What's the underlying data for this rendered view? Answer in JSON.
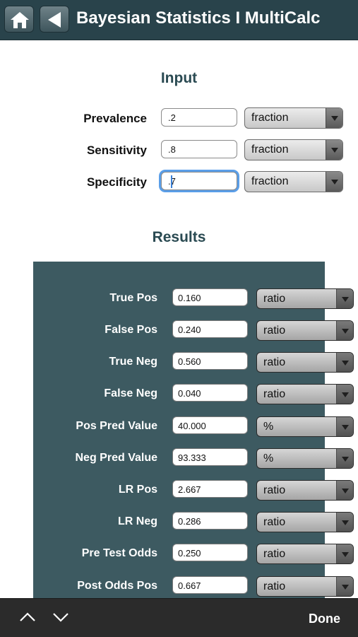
{
  "header": {
    "title": "Bayesian Statistics I MultiCalc",
    "home_icon": "home-icon",
    "back_icon": "back-arrow-icon"
  },
  "input": {
    "title": "Input",
    "rows": [
      {
        "label": "Prevalence",
        "value": ".2",
        "unit": "fraction"
      },
      {
        "label": "Sensitivity",
        "value": ".8",
        "unit": "fraction"
      },
      {
        "label": "Specificity",
        "value": ".7",
        "unit": "fraction"
      }
    ]
  },
  "results": {
    "title": "Results",
    "rows": [
      {
        "label": "True Pos",
        "value": "0.160",
        "unit": "ratio"
      },
      {
        "label": "False Pos",
        "value": "0.240",
        "unit": "ratio"
      },
      {
        "label": "True Neg",
        "value": "0.560",
        "unit": "ratio"
      },
      {
        "label": "False Neg",
        "value": "0.040",
        "unit": "ratio"
      },
      {
        "label": "Pos Pred Value",
        "value": "40.000",
        "unit": "%"
      },
      {
        "label": "Neg Pred Value",
        "value": "93.333",
        "unit": "%"
      },
      {
        "label": "LR Pos",
        "value": "2.667",
        "unit": "ratio"
      },
      {
        "label": "LR Neg",
        "value": "0.286",
        "unit": "ratio"
      },
      {
        "label": "Pre Test Odds",
        "value": "0.250",
        "unit": "ratio"
      },
      {
        "label": "Post Odds Pos",
        "value": "0.667",
        "unit": "ratio"
      }
    ]
  },
  "keyboard_toolbar": {
    "done_label": "Done"
  },
  "colors": {
    "header_bg": "#29434b",
    "panel_bg": "#3d5a61",
    "focus_ring": "#5a9ee8"
  }
}
